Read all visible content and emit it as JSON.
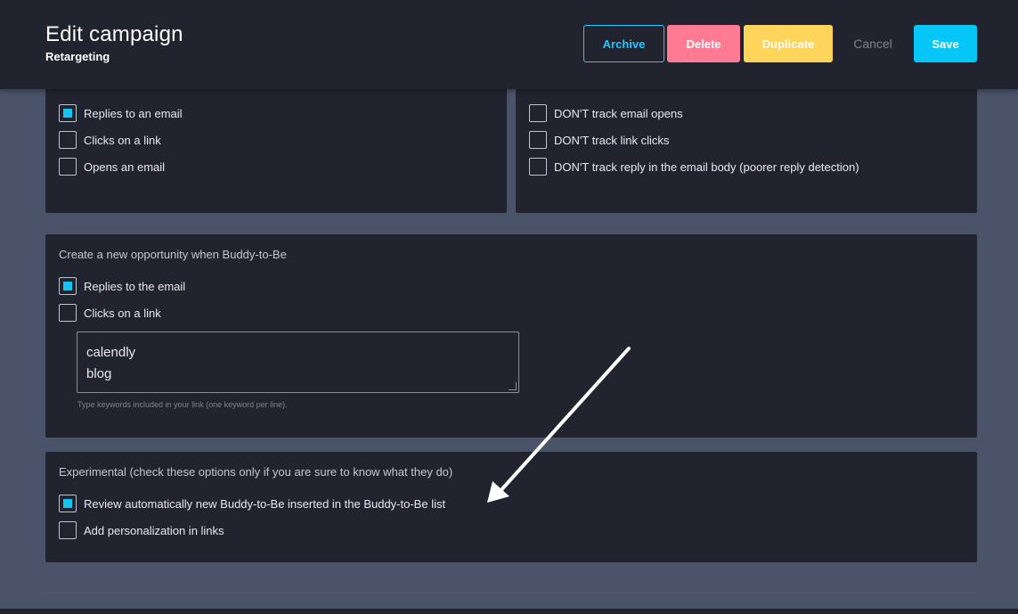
{
  "header": {
    "title": "Edit campaign",
    "subtitle": "Retargeting",
    "buttons": {
      "archive": "Archive",
      "delete": "Delete",
      "duplicate": "Duplicate",
      "cancel": "Cancel",
      "save": "Save"
    }
  },
  "panel_left": {
    "options": [
      {
        "label": "Replies to an email",
        "checked": true
      },
      {
        "label": "Clicks on a link",
        "checked": false
      },
      {
        "label": "Opens an email",
        "checked": false
      }
    ]
  },
  "panel_right": {
    "options": [
      {
        "label": "DON'T track email opens",
        "checked": false
      },
      {
        "label": "DON'T track link clicks",
        "checked": false
      },
      {
        "label": "DON'T track reply in the email body (poorer reply detection)",
        "checked": false
      }
    ]
  },
  "opportunity": {
    "heading": "Create a new opportunity when Buddy-to-Be",
    "options": [
      {
        "label": "Replies to the email",
        "checked": true
      },
      {
        "label": "Clicks on a link",
        "checked": false
      }
    ],
    "keywords": [
      "calendly",
      "blog"
    ],
    "keywords_help": "Type keywords included in your link (one keyword per line)."
  },
  "experimental": {
    "heading": "Experimental (check these options only if you are sure to know what they do)",
    "options": [
      {
        "label": "Review automatically new Buddy-to-Be inserted in the Buddy-to-Be list",
        "checked": true
      },
      {
        "label": "Add personalization in links",
        "checked": false
      }
    ]
  },
  "colors": {
    "accent": "#06c6f8",
    "delete": "#ff7b93",
    "duplicate": "#ffd45a",
    "panel": "#21232f",
    "background": "#4b5368"
  }
}
